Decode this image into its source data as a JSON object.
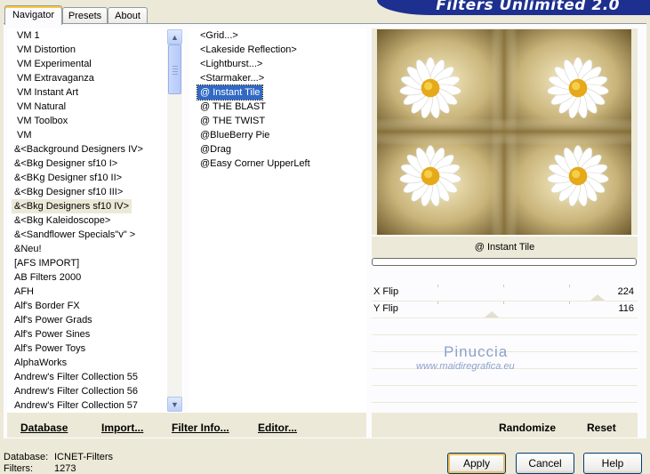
{
  "app": {
    "title": "Filters Unlimited 2.0"
  },
  "tabs": [
    {
      "label": "Navigator",
      "active": true
    },
    {
      "label": "Presets",
      "active": false
    },
    {
      "label": "About",
      "active": false
    }
  ],
  "categories": [
    "VM 1",
    "VM Distortion",
    "VM Experimental",
    "VM Extravaganza",
    "VM Instant Art",
    "VM Natural",
    "VM Toolbox",
    "VM",
    "&<Background Designers IV>",
    "&<Bkg Designer sf10 I>",
    "&<BKg Designer sf10 II>",
    "&<Bkg Designer sf10 III>",
    "&<Bkg Designers sf10 IV>",
    "&<Bkg Kaleidoscope>",
    "&<Sandflower Specials\"v\" >",
    "&Neu!",
    "[AFS IMPORT]",
    "AB Filters 2000",
    "AFH",
    "Alf's Border FX",
    "Alf's Power Grads",
    "Alf's Power Sines",
    "Alf's Power Toys",
    "AlphaWorks",
    "Andrew's Filter Collection 55",
    "Andrew's Filter Collection 56",
    "Andrew's Filter Collection 57"
  ],
  "selected_category": "&<Bkg Designers sf10 IV>",
  "filters": [
    "<Grid...>",
    "<Lakeside Reflection>",
    "<Lightburst...>",
    "<Starmaker...>",
    "@ Instant Tile",
    "@ THE BLAST",
    "@ THE TWIST",
    "@BlueBerry Pie",
    "@Drag",
    "@Easy Corner UpperLeft"
  ],
  "selected_filter": "@ Instant Tile",
  "left_buttons": {
    "database": "Database",
    "import": "Import...",
    "filter_info": "Filter Info...",
    "editor": "Editor..."
  },
  "right_buttons": {
    "randomize": "Randomize",
    "reset": "Reset"
  },
  "preview": {
    "filter_name": "@ Instant Tile"
  },
  "params": [
    {
      "label": "X Flip",
      "value": "224",
      "max": 255
    },
    {
      "label": "Y Flip",
      "value": "116",
      "max": 255
    }
  ],
  "watermark": {
    "name": "Pinuccia",
    "url": "www.maidiregrafica.eu"
  },
  "footer": {
    "database_label": "Database:",
    "database_value": "ICNET-Filters",
    "filters_label": "Filters:",
    "filters_value": "1273"
  },
  "dialog_buttons": {
    "apply": "Apply",
    "cancel": "Cancel",
    "help": "Help"
  },
  "colors": {
    "banner": "#1d2f8f",
    "selection": "#316ac5",
    "face": "#ece9d8"
  }
}
